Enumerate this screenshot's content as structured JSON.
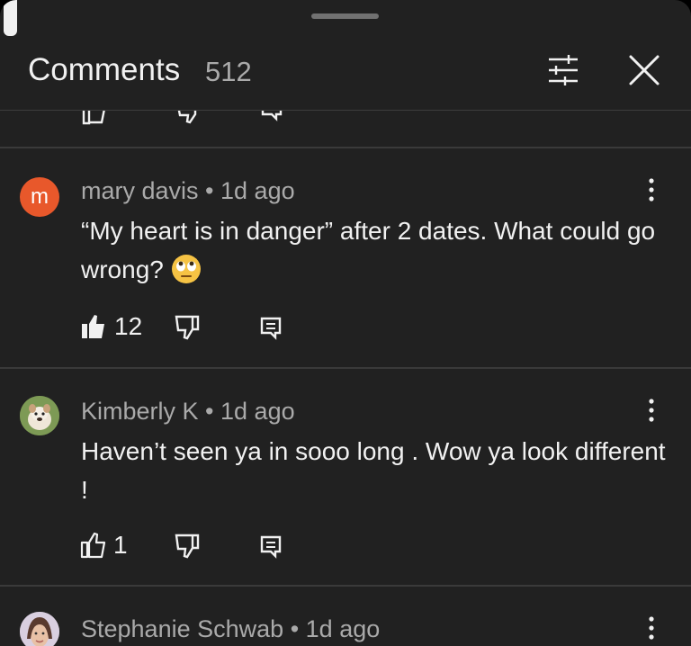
{
  "header": {
    "title": "Comments",
    "count": "512",
    "filter_icon": "filter-icon",
    "close_icon": "close-icon"
  },
  "comments": [
    {
      "author": "mary davis",
      "separator": "•",
      "time": "1d ago",
      "avatar_letter": "m",
      "avatar_color": "#e8582b",
      "text": "“My heart is in danger” after 2 dates. What could go wrong? ",
      "emoji": "rolling-eyes-emoji",
      "likes": "12",
      "liked": true
    },
    {
      "author": "Kimberly K",
      "separator": "•",
      "time": "1d ago",
      "avatar": "bulldog-avatar",
      "text": "Haven’t seen ya in sooo long . Wow ya look different !",
      "likes": "1",
      "liked": false
    },
    {
      "author": "Stephanie Schwab",
      "separator": "•",
      "time": "1d ago",
      "avatar": "profile-photo-avatar"
    }
  ],
  "colors": {
    "background": "#212121",
    "text_primary": "#f1f1f1",
    "text_secondary": "#aaaaaa",
    "divider": "#3a3a3a",
    "accent_avatar": "#e8582b"
  }
}
